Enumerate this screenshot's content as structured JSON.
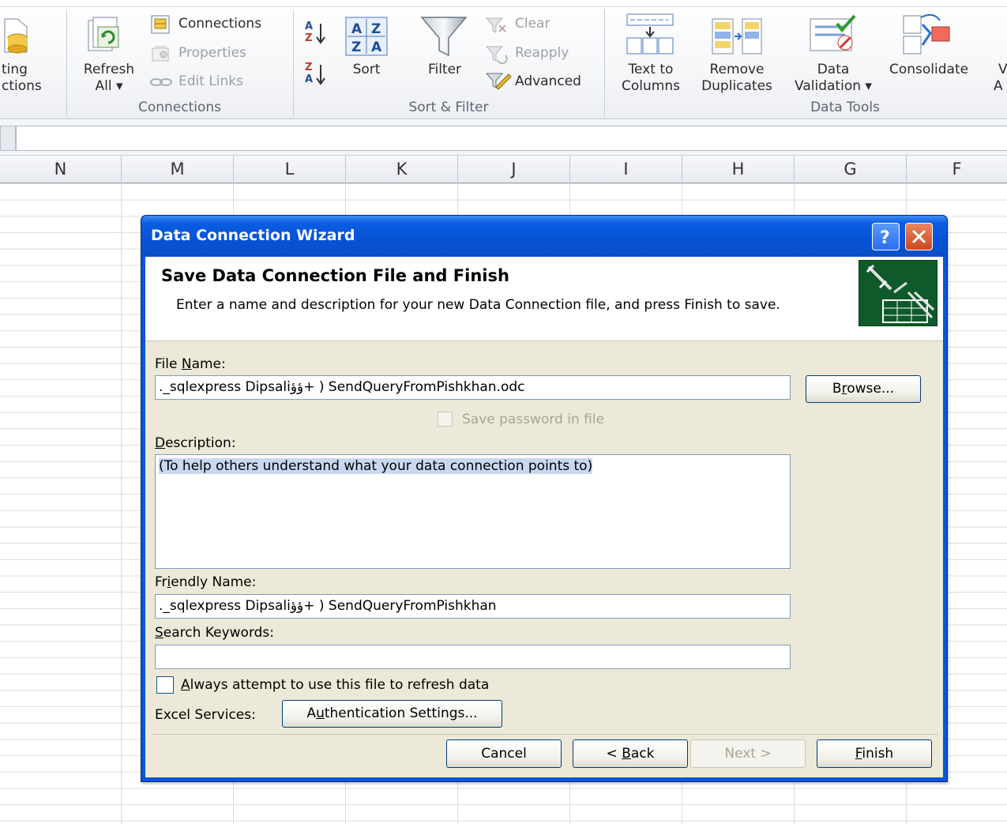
{
  "ribbon": {
    "cut_group": {
      "line1": "ting",
      "line2": "ctions"
    },
    "refresh": {
      "line1": "Refresh",
      "line2": "All ▾"
    },
    "connections": {
      "connections": "Connections",
      "properties": "Properties",
      "edit_links": "Edit Links",
      "label": "Connections"
    },
    "sort_filter": {
      "sort": "Sort",
      "filter": "Filter",
      "clear": "Clear",
      "reapply": "Reapply",
      "advanced": "Advanced",
      "label": "Sort & Filter"
    },
    "data_tools": {
      "text_to_columns": {
        "line1": "Text to",
        "line2": "Columns"
      },
      "remove_duplicates": {
        "line1": "Remove",
        "line2": "Duplicates"
      },
      "data_validation": {
        "line1": "Data",
        "line2": "Validation ▾"
      },
      "consolidate": "Consolidate",
      "whatif": {
        "line1": "V",
        "line2": "A"
      },
      "label": "Data Tools"
    }
  },
  "columns": [
    "N",
    "M",
    "L",
    "K",
    "J",
    "I",
    "H",
    "G",
    "F"
  ],
  "dialog": {
    "title": "Data Connection Wizard",
    "heading": "Save Data Connection File and Finish",
    "description": "Enter a name and description for your new Data Connection file, and press Finish to save.",
    "file_name": {
      "label_pre": "File ",
      "label_u": "N",
      "label_post": "ame:",
      "value": "._sqlexpress Dipsaliؤؤ+ ) SendQueryFromPishkhan.odc"
    },
    "browse": {
      "pre": "B",
      "u": "r",
      "post": "owse..."
    },
    "save_password": "Save password in file",
    "description_field": {
      "label_u": "D",
      "label_post": "escription:",
      "value": "(To help others understand what your data connection points to)"
    },
    "friendly_name": {
      "label_pre": "Fr",
      "label_u": "i",
      "label_post": "endly Name:",
      "value": "._sqlexpress Dipsaliؤؤ+ ) SendQueryFromPishkhan"
    },
    "search_keywords": {
      "label_u": "S",
      "label_post": "earch Keywords:",
      "value": ""
    },
    "always_attempt": {
      "u": "A",
      "post": "lways attempt to use this file to refresh data"
    },
    "excel_services": "Excel Services:",
    "auth_settings": {
      "pre": "A",
      "u": "u",
      "post": "thentication Settings..."
    },
    "buttons": {
      "cancel": "Cancel",
      "back": {
        "pre": "< ",
        "u": "B",
        "post": "ack"
      },
      "next": "Next >",
      "finish": {
        "u": "F",
        "post": "inish"
      }
    }
  }
}
